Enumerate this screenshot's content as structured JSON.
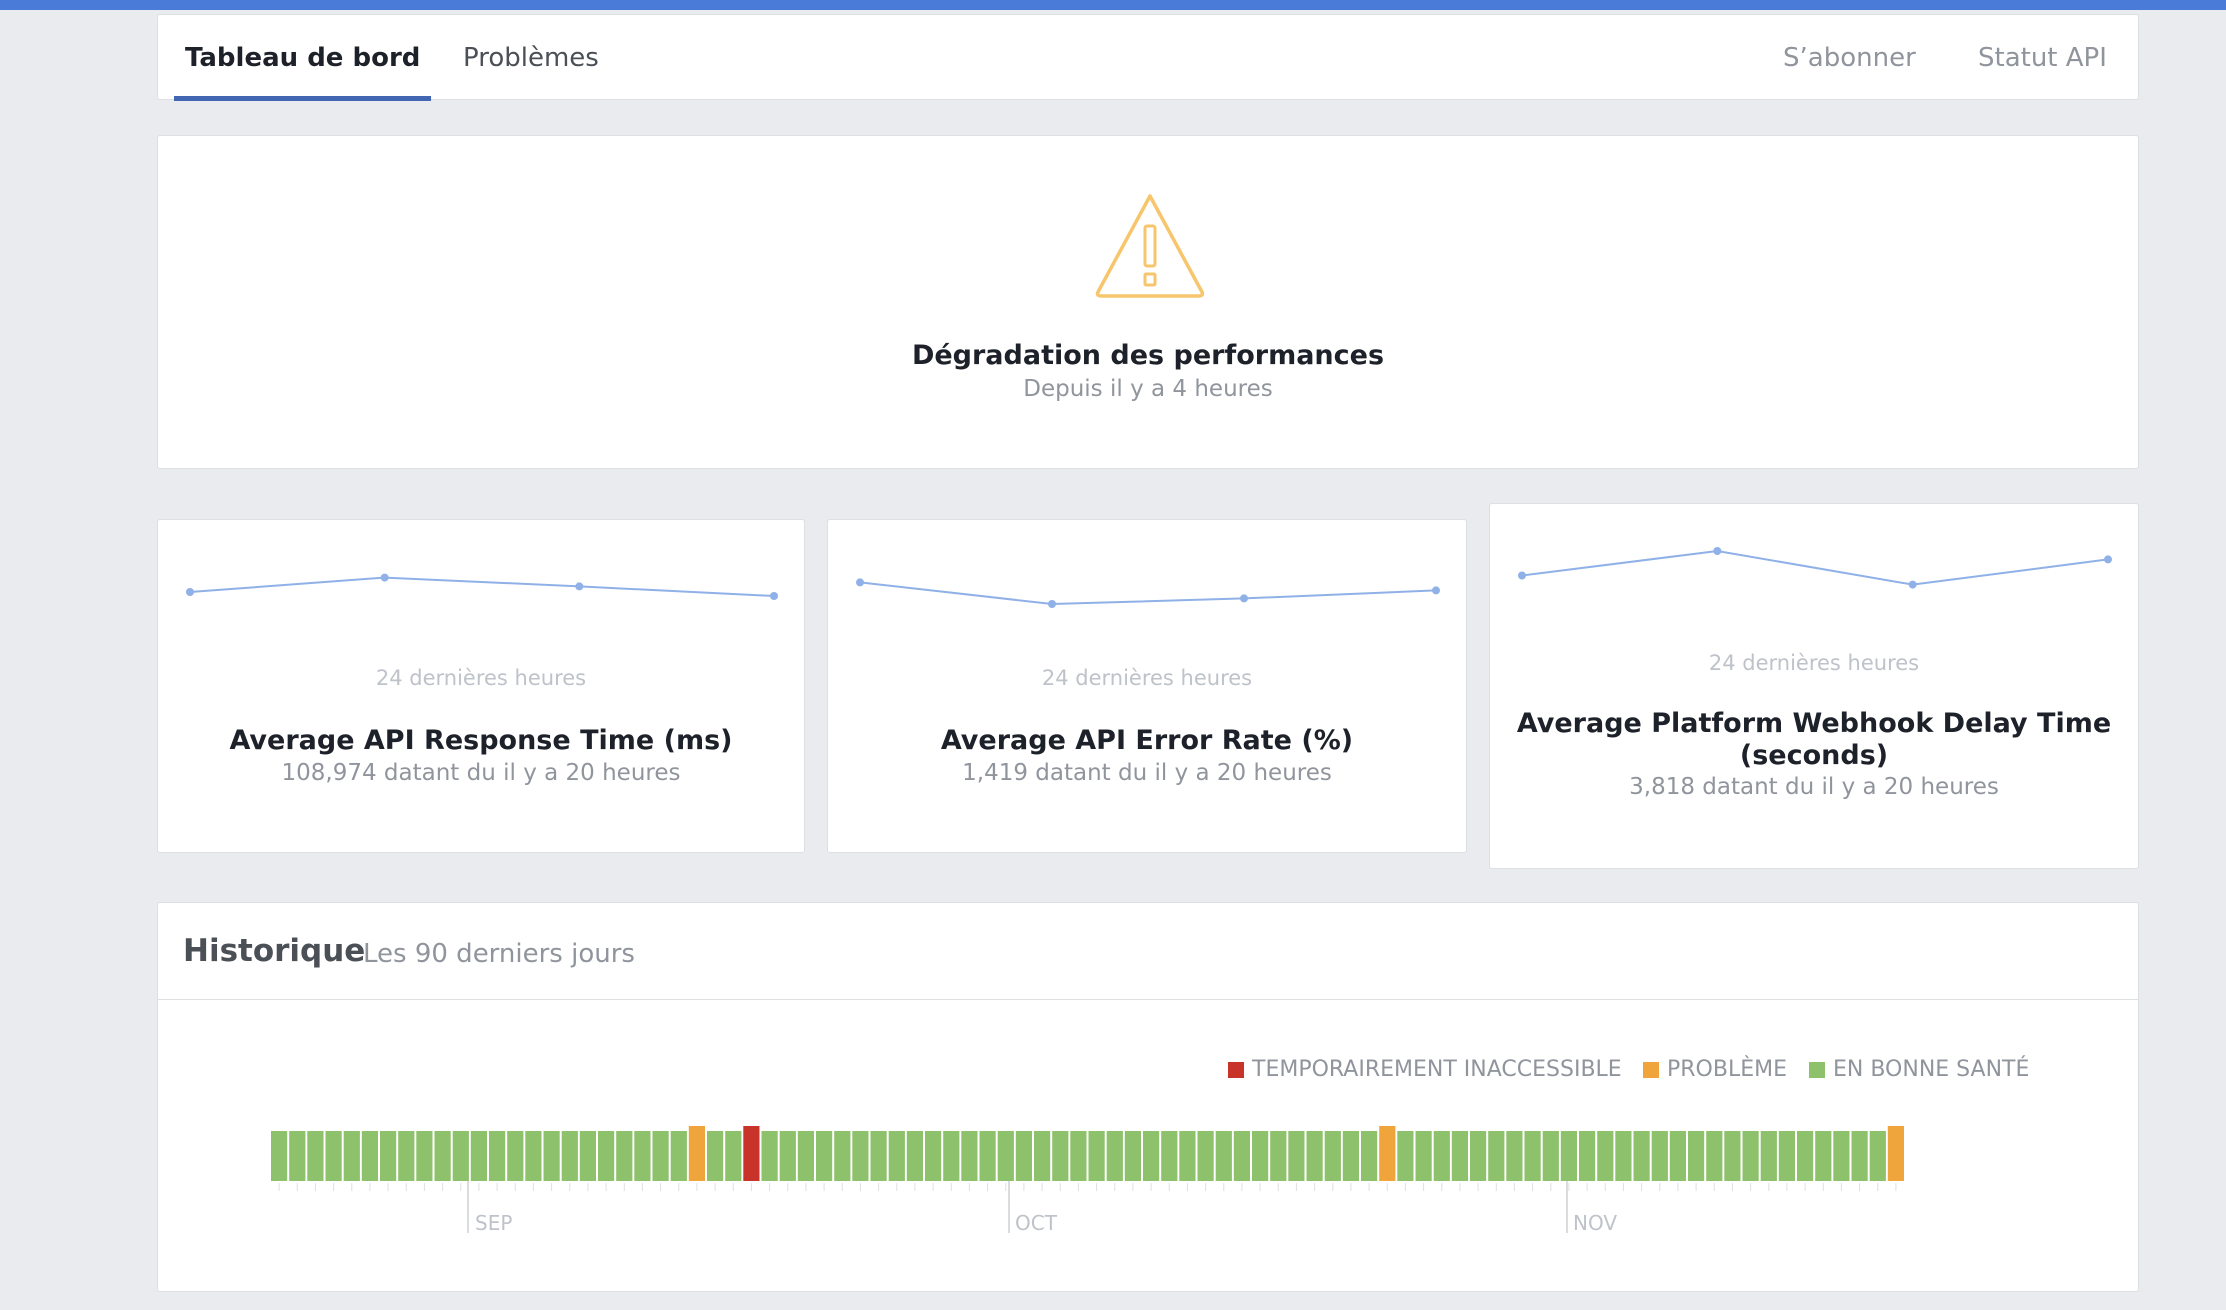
{
  "nav": {
    "tabs": [
      {
        "label": "Tableau de bord",
        "active": true
      },
      {
        "label": "Problèmes",
        "active": false
      }
    ],
    "links": [
      "S’abonner",
      "Statut API"
    ]
  },
  "status": {
    "icon": "warning-triangle-icon",
    "color": "#f7c56b",
    "title": "Dégradation des performances",
    "subtitle": "Depuis il y a 4 heures"
  },
  "metrics": [
    {
      "period": "24 dernières heures",
      "title": "Average API Response Time (ms)",
      "subtitle": "108,974 datant du il y a 20 heures",
      "trend": [
        0.6,
        0.78,
        0.67,
        0.55
      ]
    },
    {
      "period": "24 dernières heures",
      "title": "Average API Error Rate (%)",
      "subtitle": "1,419 datant du il y a 20 heures",
      "trend": [
        0.72,
        0.45,
        0.52,
        0.62
      ]
    },
    {
      "period": "24 dernières heures",
      "title": "Average Platform Webhook Delay Time (seconds)",
      "subtitle": "3,818 datant du il y a 20 heures",
      "trend": [
        0.55,
        0.9,
        0.42,
        0.78
      ]
    }
  ],
  "history": {
    "title": "Historique",
    "subtitle": "Les 90 derniers jours",
    "legend": [
      {
        "label": "TEMPORAIREMENT INACCESSIBLE",
        "color": "#c9342a"
      },
      {
        "label": "PROBLÈME",
        "color": "#f0a53c"
      },
      {
        "label": "EN BONNE SANTÉ",
        "color": "#8ec16c"
      }
    ],
    "months": [
      "SEP",
      "OCT",
      "NOV"
    ],
    "days": [
      "g",
      "g",
      "g",
      "g",
      "g",
      "g",
      "g",
      "g",
      "g",
      "g",
      "g",
      "g",
      "g",
      "g",
      "g",
      "g",
      "g",
      "g",
      "g",
      "g",
      "g",
      "g",
      "g",
      "p",
      "g",
      "g",
      "o",
      "g",
      "g",
      "g",
      "g",
      "g",
      "g",
      "g",
      "g",
      "g",
      "g",
      "g",
      "g",
      "g",
      "g",
      "g",
      "g",
      "g",
      "g",
      "g",
      "g",
      "g",
      "g",
      "g",
      "g",
      "g",
      "g",
      "g",
      "g",
      "g",
      "g",
      "g",
      "g",
      "g",
      "g",
      "p",
      "g",
      "g",
      "g",
      "g",
      "g",
      "g",
      "g",
      "g",
      "g",
      "g",
      "g",
      "g",
      "g",
      "g",
      "g",
      "g",
      "g",
      "g",
      "g",
      "g",
      "g",
      "g",
      "g",
      "g",
      "g",
      "g",
      "g",
      "p"
    ]
  }
}
